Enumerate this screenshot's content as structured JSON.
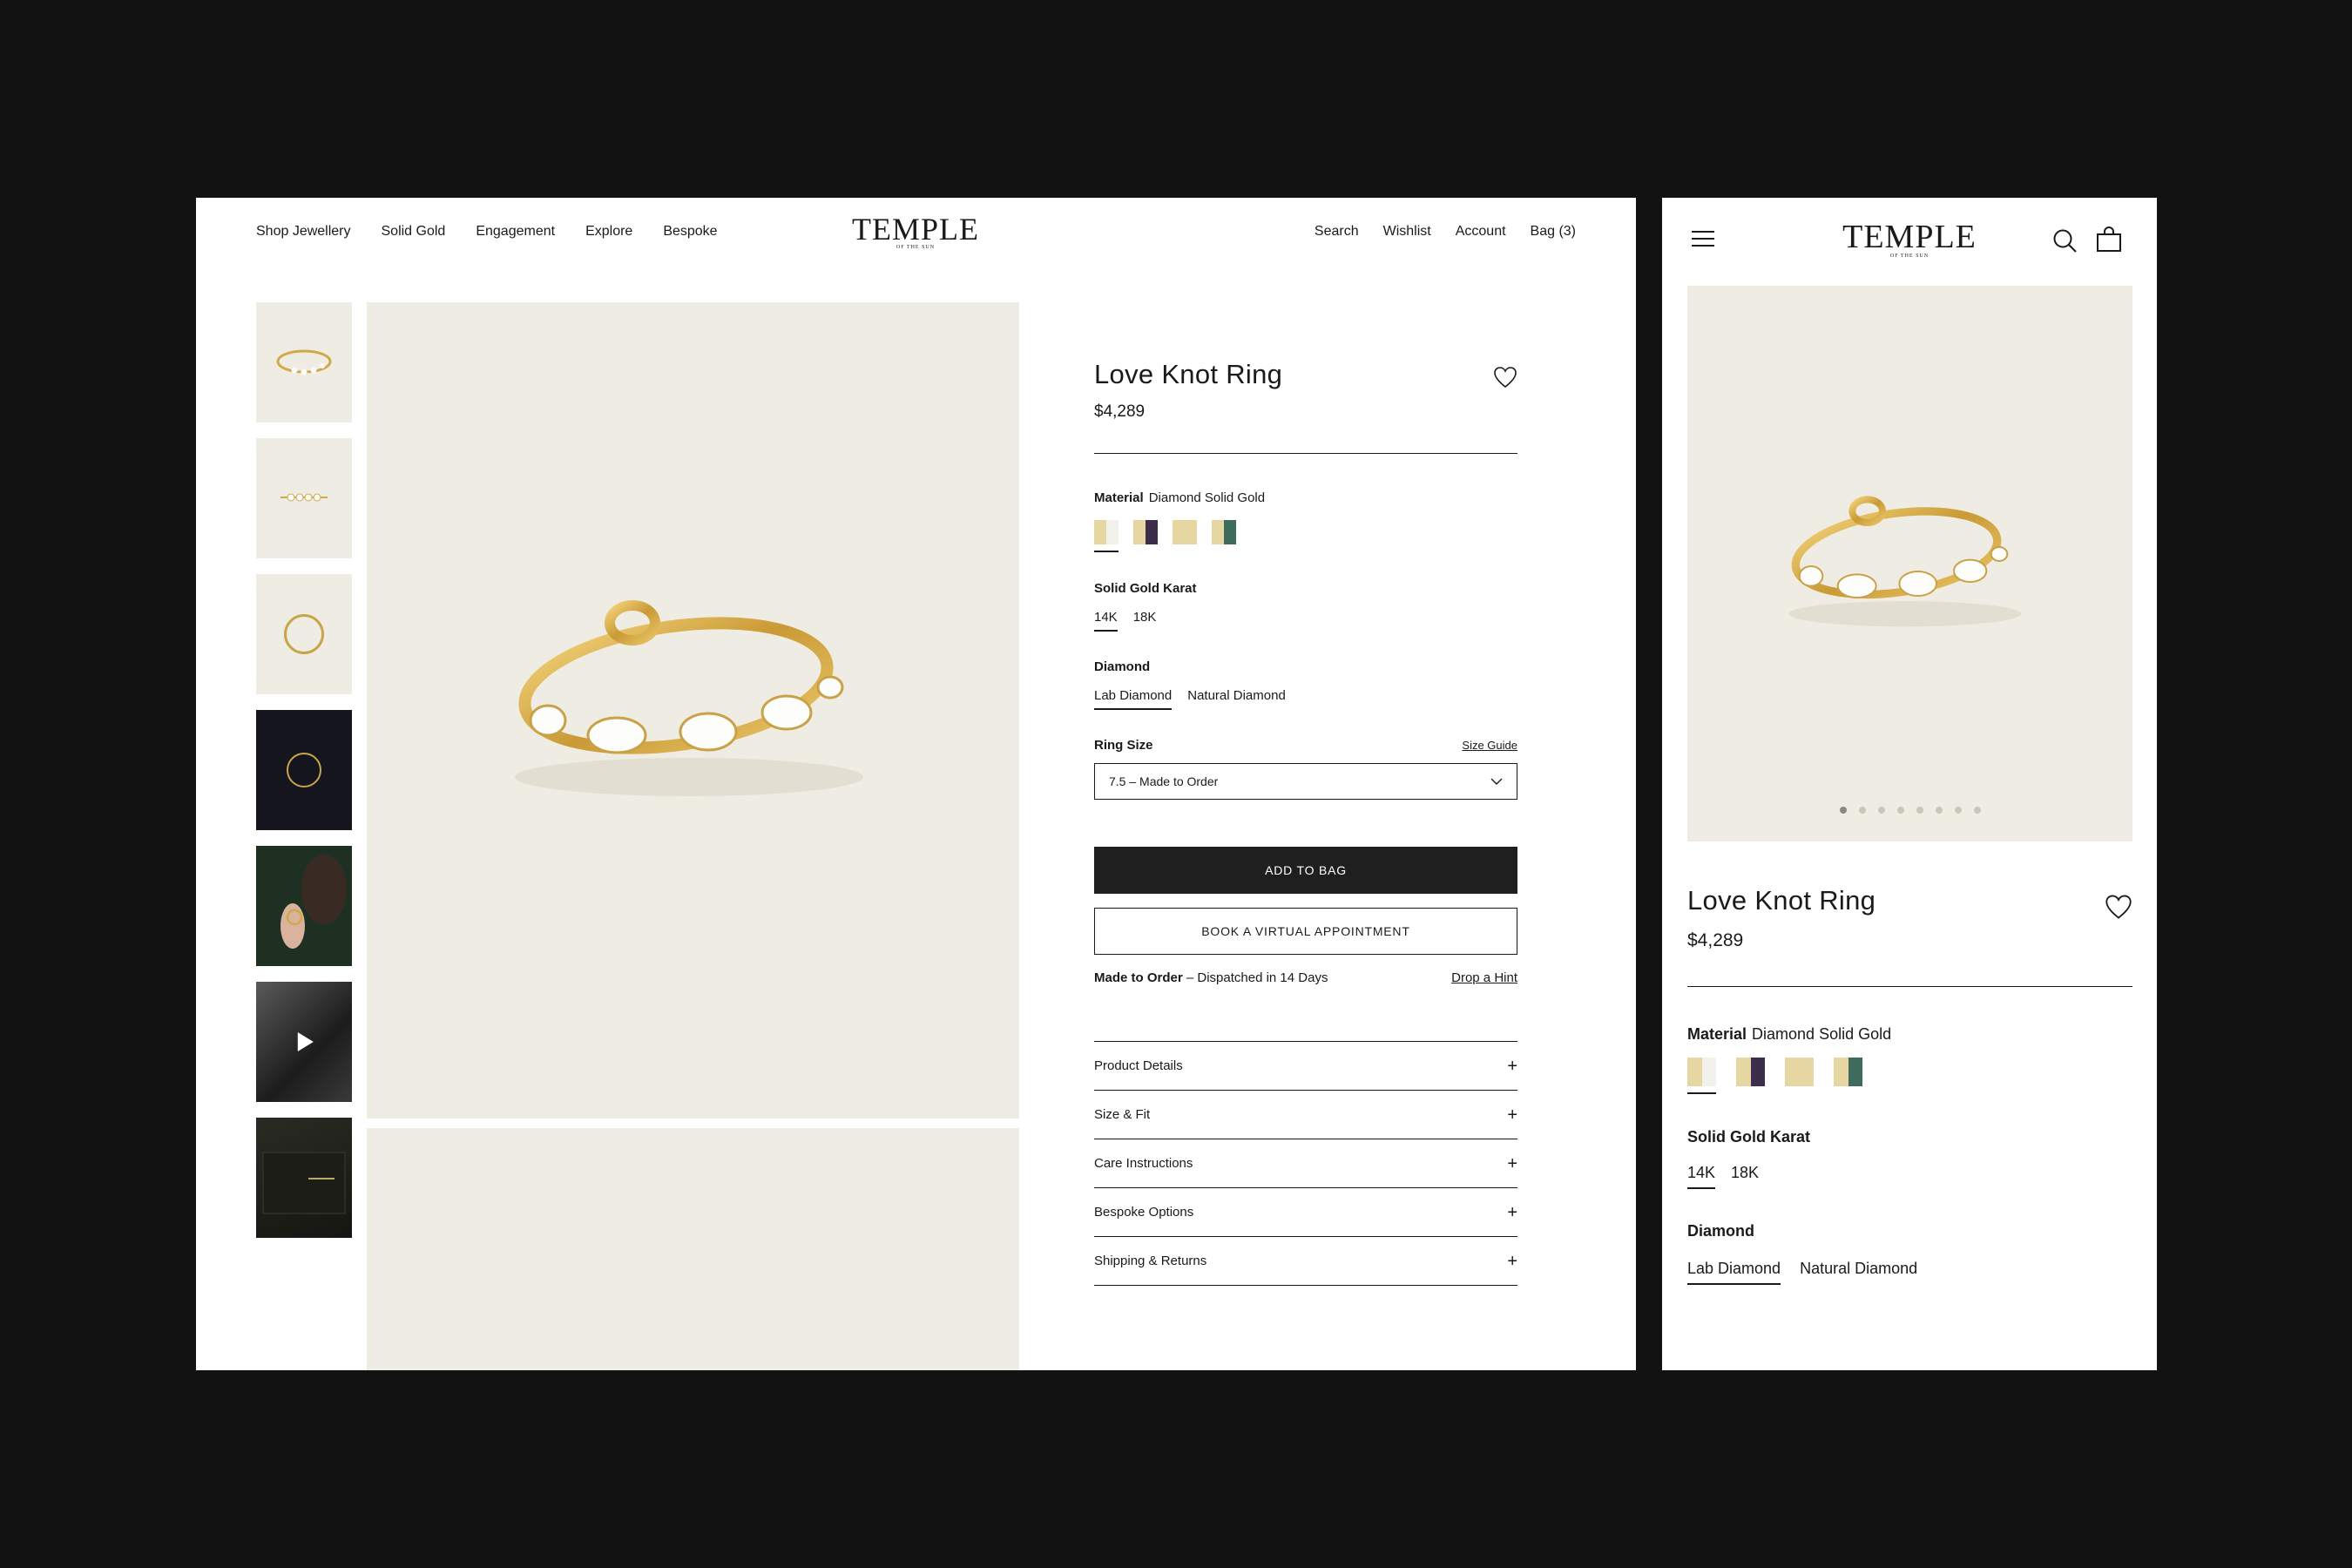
{
  "desktop": {
    "nav": [
      "Shop Jewellery",
      "Solid Gold",
      "Engagement",
      "Explore",
      "Bespoke"
    ],
    "utility": [
      "Search",
      "Wishlist",
      "Account",
      "Bag (3)"
    ]
  },
  "brand": {
    "name": "TEMPLE",
    "tagline": "OF THE SUN"
  },
  "product": {
    "title": "Love Knot Ring",
    "price": "$4,289",
    "material": {
      "label": "Material",
      "value": "Diamond Solid Gold"
    },
    "swatches": [
      {
        "name": "Diamond Solid Gold",
        "left": "#e6d7a2",
        "right": "#f3f1ec",
        "selected": true
      },
      {
        "name": "Sapphire Solid Gold",
        "left": "#e6d7a2",
        "right": "#3c2d4c",
        "selected": false
      },
      {
        "name": "Solid Gold",
        "left": "#e6d7a2",
        "right": "#e6d7a2",
        "selected": false
      },
      {
        "name": "Emerald Solid Gold",
        "left": "#e6d7a2",
        "right": "#3f6b5c",
        "selected": false
      }
    ],
    "karat": {
      "label": "Solid Gold Karat",
      "options": [
        "14K",
        "18K"
      ],
      "selected": "14K"
    },
    "diamond": {
      "label": "Diamond",
      "options": [
        "Lab Diamond",
        "Natural Diamond"
      ],
      "selected": "Lab Diamond"
    },
    "ring_size": {
      "label": "Ring Size",
      "guide": "Size Guide",
      "value": "7.5 – Made to Order"
    },
    "add_to_bag": "ADD TO BAG",
    "appointment": "BOOK A VIRTUAL APPOINTMENT",
    "dispatch": {
      "bold": "Made to Order",
      "rest": " – Dispatched in 14 Days"
    },
    "drop_hint": "Drop a Hint",
    "accordion": [
      "Product Details",
      "Size & Fit",
      "Care Instructions",
      "Bespoke Options",
      "Shipping & Returns"
    ]
  },
  "gallery": {
    "thumbnails": [
      "ring-angle",
      "ring-front",
      "ring-top",
      "ring-box-dark",
      "model-hand",
      "model-video",
      "packaging"
    ],
    "dot_count": 8,
    "active_dot": 1
  },
  "colors": {
    "accent": "#1f1f1f",
    "background": "#efede3",
    "gold": "#d4ae4f"
  }
}
